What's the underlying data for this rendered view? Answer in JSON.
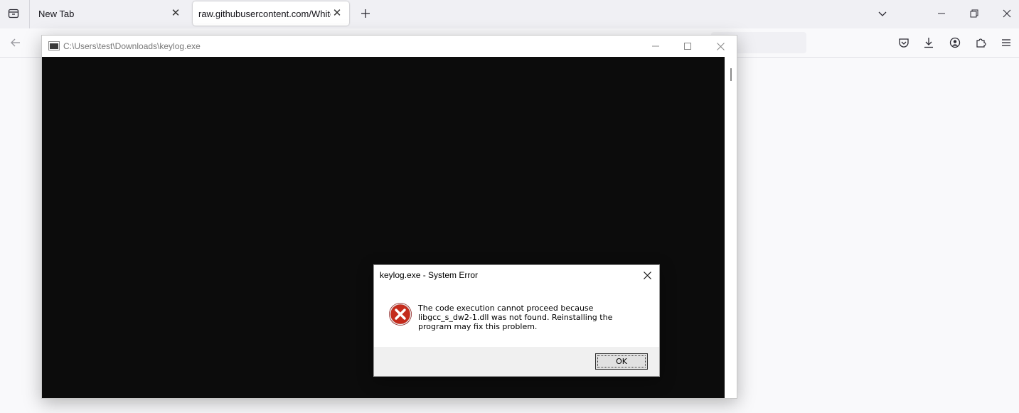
{
  "browser": {
    "tabs": [
      {
        "label": "New Tab",
        "active": false
      },
      {
        "label": "raw.githubusercontent.com/Whitec",
        "active": true
      }
    ],
    "icons": {
      "tab_overview": "tab-overview-icon",
      "new_tab": "plus-icon",
      "tab_list": "chevron-down-icon",
      "back": "back-arrow-icon",
      "pocket": "pocket-icon",
      "downloads": "download-icon",
      "account": "account-icon",
      "extensions": "puzzle-icon",
      "menu": "hamburger-menu-icon"
    }
  },
  "console": {
    "title": "C:\\Users\\test\\Downloads\\keylog.exe"
  },
  "dialog": {
    "title": "keylog.exe - System Error",
    "message": "The code execution cannot proceed because libgcc_s_dw2-1.dll was not found. Reinstalling the program may fix this problem.",
    "ok_label": "OK",
    "icon": "error-icon",
    "colors": {
      "error": "#c42b1c"
    }
  }
}
